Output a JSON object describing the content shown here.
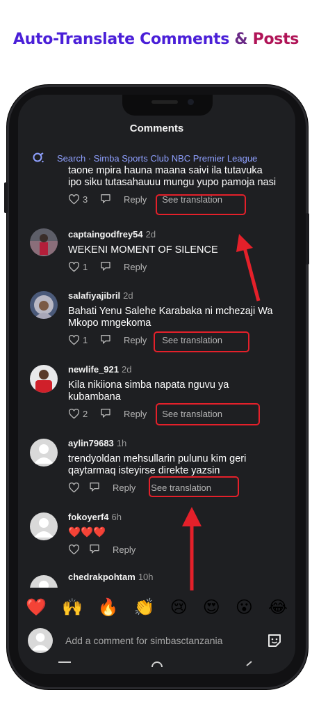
{
  "headline": {
    "part1": "Auto-Translate Comments ",
    "amp": "&",
    "part2": " Posts"
  },
  "header": {
    "title": "Comments"
  },
  "search": {
    "text": "Search · Simba Sports Club NBC Premier League"
  },
  "comments": [
    {
      "text": "taone mpira hauna maana saivi ila tutavuka ipo siku tutasahauuu mungu yupo pamoja nasi",
      "likes": "3",
      "reply": "Reply",
      "translate": "See translation"
    },
    {
      "user": "captaingodfrey54",
      "time": "2d",
      "text": "WEKENI MOMENT OF SILENCE",
      "likes": "1",
      "reply": "Reply"
    },
    {
      "user": "salafiyajibril",
      "time": "2d",
      "text": "Bahati Yenu Salehe Karabaka ni mchezaji Wa Mkopo mngekoma",
      "likes": "1",
      "reply": "Reply",
      "translate": "See translation"
    },
    {
      "user": "newlife_921",
      "time": "2d",
      "text": "Kila nikiiona simba napata nguvu ya kubambana",
      "likes": "2",
      "reply": "Reply",
      "translate": "See translation"
    },
    {
      "user": "aylin79683",
      "time": "1h",
      "text": "trendyoldan mehsullarin pulunu kim geri qaytarmaq isteyirse direkte yazsin",
      "reply": "Reply",
      "translate": "See translation"
    },
    {
      "user": "fokoyerf4",
      "time": "6h",
      "text": "❤️❤️❤️",
      "reply": "Reply"
    },
    {
      "user": "chedrakpohtam",
      "time": "10h"
    }
  ],
  "reactions": [
    "❤️",
    "🙌",
    "🔥",
    "👏",
    "😢",
    "😍",
    "😮",
    "😂"
  ],
  "composer": {
    "placeholder": "Add a comment for simbasctanzania"
  },
  "colors": {
    "accent": "#8fa0ff",
    "highlight": "#e4202a",
    "background": "#1e1f22"
  }
}
